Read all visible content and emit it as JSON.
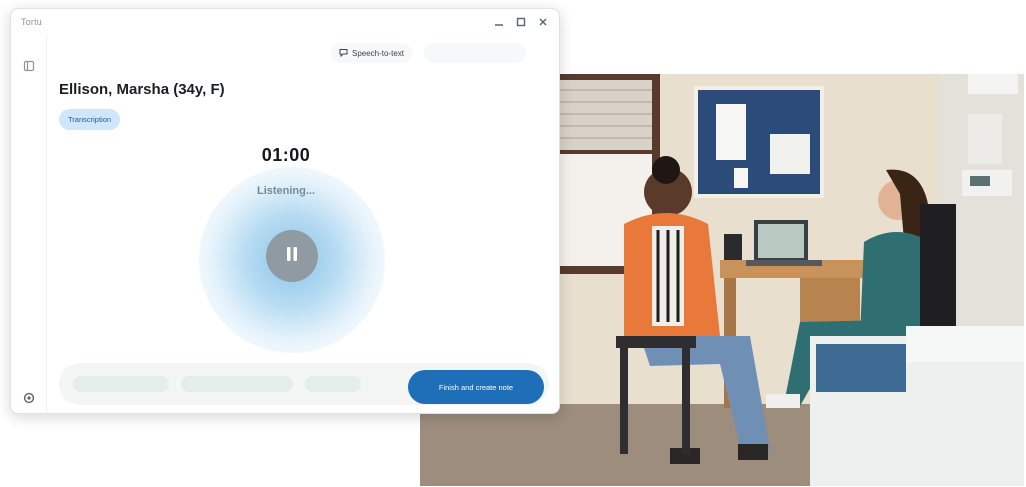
{
  "window": {
    "app_name": "Tortu"
  },
  "toolbar": {
    "speech_to_text_label": "Speech-to-text"
  },
  "patient": {
    "name": "Ellison, Marsha (34y, F)"
  },
  "session": {
    "tag_label": "Transcription",
    "timer": "01:00",
    "status": "Listening..."
  },
  "footer": {
    "finish_label": "Finish and create note"
  },
  "colors": {
    "accent": "#1f6fb8",
    "tag_background": "#cfe6fb",
    "pause_button": "#8f9aa3"
  },
  "icons": {
    "menu": "menu-icon",
    "settings": "settings-icon",
    "minimize": "minimize-icon",
    "maximize": "maximize-icon",
    "close": "close-icon",
    "speech": "speech-bubble-icon",
    "pause": "pause-icon"
  }
}
